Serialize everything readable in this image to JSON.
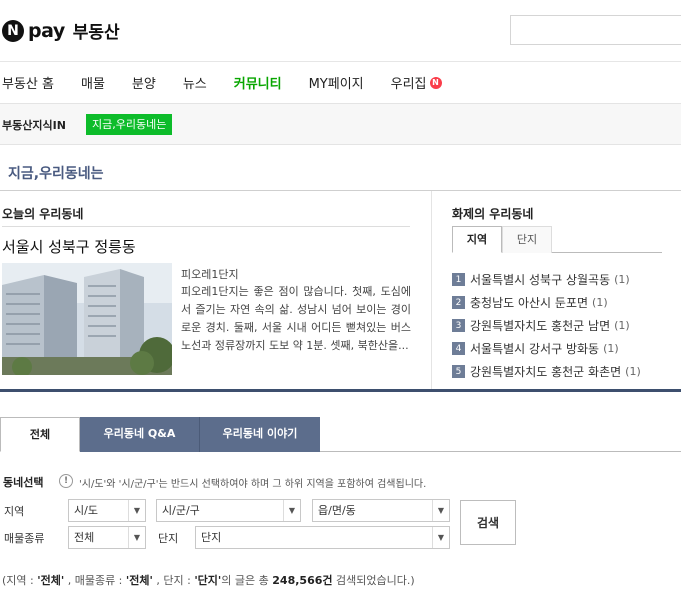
{
  "brand": {
    "badge": "N",
    "name": "pay",
    "service": "부동산"
  },
  "gnb": {
    "items": [
      {
        "label": "부동산 홈"
      },
      {
        "label": "매물"
      },
      {
        "label": "분양"
      },
      {
        "label": "뉴스"
      },
      {
        "label": "커뮤니티",
        "active": true
      },
      {
        "label": "MY페이지"
      },
      {
        "label": "우리집",
        "badge": "N"
      }
    ]
  },
  "subnav": {
    "label": "부동산지식IN",
    "active": "지금,우리동네는"
  },
  "page": {
    "title": "지금,우리동네는"
  },
  "today": {
    "title": "오늘의 우리동네",
    "place": "서울시 성북구 정릉동",
    "name": "피오레1단지",
    "desc": "피오레1단지는 좋은 점이 많습니다. 첫째, 도심에서 즐기는 자연 속의 삶. 성남시 넘어 보이는 경이로운 경치. 둘째, 서울 시내 어디든 뻗쳐있는 버스 노선과 정류장까지 도보 약 1분. 셋째, 북한산을..."
  },
  "hot": {
    "title": "화제의 우리동네",
    "tabs": [
      "지역",
      "단지"
    ],
    "items": [
      {
        "num": "1",
        "label": "서울특별시 성북구 상월곡동",
        "count": "(1)"
      },
      {
        "num": "2",
        "label": "충청남도 아산시 둔포면",
        "count": "(1)"
      },
      {
        "num": "3",
        "label": "강원특별자치도 홍천군 남면",
        "count": "(1)"
      },
      {
        "num": "4",
        "label": "서울특별시 강서구 방화동",
        "count": "(1)"
      },
      {
        "num": "5",
        "label": "강원특별자치도 홍천군 화촌면",
        "count": "(1)"
      }
    ]
  },
  "tabs": [
    "전체",
    "우리동네 Q&A",
    "우리동네 이야기"
  ],
  "filter": {
    "title": "동네선택",
    "help_icon": "!",
    "help": "'시/도'와 '시/군/구'는 반드시 선택하여야 하며 그 하위 지역을 포함하여 검색됩니다.",
    "region_label": "지역",
    "sido": "시/도",
    "sigungu": "시/군/구",
    "dong": "읍/면/동",
    "type_label": "매물종류",
    "type": "전체",
    "complex_label": "단지",
    "complex": "단지",
    "search": "검색"
  },
  "result": {
    "prefix": "(지역 : ",
    "region": "'전체'",
    "mid1": " , 매물종류 : ",
    "type": "'전체'",
    "mid2": " , 단지 : ",
    "complex": "'단지'",
    "mid3": "의 글은 총 ",
    "count": "248,566건",
    "suffix": " 검색되었습니다.)"
  },
  "icons": [
    "info-icon",
    "dropdown-arrow-icon",
    "new-badge-icon"
  ],
  "colors": {
    "accent_green": "#08a600",
    "title_navy": "#495a80",
    "tab_dark": "#5c6d8c",
    "subnav_green": "#0dbc2a"
  }
}
